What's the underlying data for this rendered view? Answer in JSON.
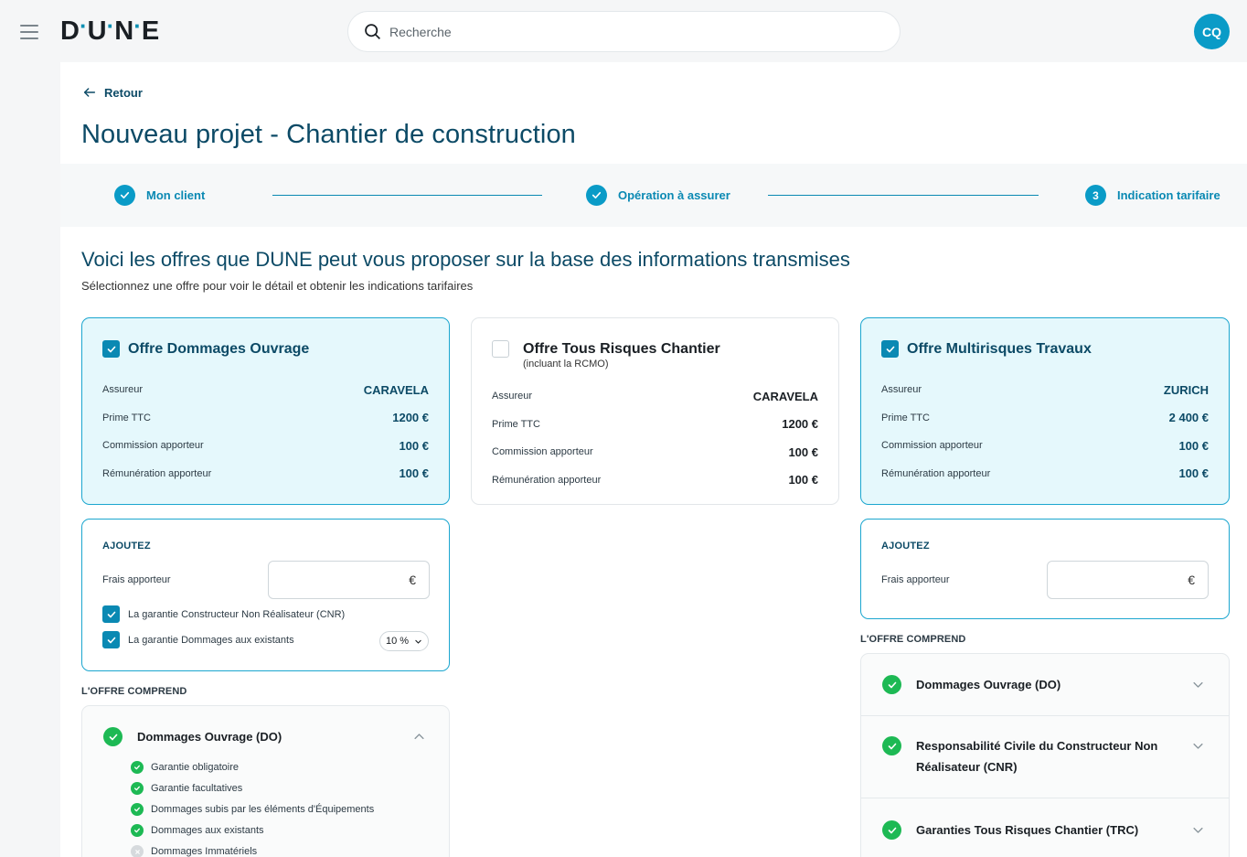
{
  "header": {
    "logo": "DUNE",
    "search_placeholder": "Recherche",
    "avatar_initials": "CQ"
  },
  "nav": {
    "back_label": "Retour",
    "page_title": "Nouveau projet - Chantier de construction"
  },
  "stepper": {
    "steps": [
      {
        "label": "Mon client",
        "state": "done"
      },
      {
        "label": "Opération à assurer",
        "state": "done"
      },
      {
        "label": "Indication tarifaire",
        "state": "current",
        "number": "3"
      }
    ]
  },
  "offers": {
    "title": "Voici les offres que DUNE peut vous proposer sur la base des informations transmises",
    "subtitle": "Sélectionnez une offre pour voir le détail et obtenir les indications tarifaires",
    "cards": [
      {
        "title": "Offre Dommages Ouvrage",
        "subtitle": "",
        "selected": true,
        "rows": [
          {
            "label": "Assureur",
            "value": "CARAVELA"
          },
          {
            "label": "Prime TTC",
            "value": "1200 €"
          },
          {
            "label": "Commission apporteur",
            "value": "100 €"
          },
          {
            "label": "Rémunération apporteur",
            "value": "100 €"
          }
        ]
      },
      {
        "title": "Offre Tous Risques Chantier",
        "subtitle": "(incluant la RCMO)",
        "selected": false,
        "rows": [
          {
            "label": "Assureur",
            "value": "CARAVELA"
          },
          {
            "label": "Prime TTC",
            "value": "1200 €"
          },
          {
            "label": "Commission apporteur",
            "value": "100 €"
          },
          {
            "label": "Rémunération apporteur",
            "value": "100 €"
          }
        ]
      },
      {
        "title": "Offre Multirisques Travaux",
        "subtitle": "",
        "selected": true,
        "rows": [
          {
            "label": "Assureur",
            "value": "ZURICH"
          },
          {
            "label": "Prime TTC",
            "value": "2 400 €"
          },
          {
            "label": "Commission apporteur",
            "value": "100 €"
          },
          {
            "label": "Rémunération apporteur",
            "value": "100 €"
          }
        ]
      }
    ]
  },
  "addons": {
    "title": "AJOUTEZ",
    "fee_label": "Frais apporteur",
    "currency": "€",
    "cnr_label": "La garantie Constructeur Non Réalisateur (CNR)",
    "cnr_checked": true,
    "existing_label": "La garantie Dommages aux existants",
    "existing_checked": true,
    "existing_rate": "10 %"
  },
  "included": {
    "section_label": "L'OFFRE COMPREND",
    "left": {
      "title": "Dommages Ouvrage (DO)",
      "expanded": true,
      "items": [
        {
          "label": "Garantie obligatoire",
          "included": true
        },
        {
          "label": "Garantie facultatives",
          "included": true
        },
        {
          "label": "Dommages subis par les éléments d'Équipements",
          "included": true
        },
        {
          "label": "Dommages aux existants",
          "included": true
        },
        {
          "label": "Dommages Immatériels",
          "included": false
        }
      ]
    },
    "right": [
      {
        "title_line1": "Dommages Ouvrage (DO)",
        "title_line2": ""
      },
      {
        "title_line1": "Responsabilité Civile du Constructeur Non",
        "title_line2": "Réalisateur (CNR)"
      },
      {
        "title_line1": "Garanties Tous Risques Chantier (TRC)",
        "title_line2": ""
      }
    ]
  },
  "colors": {
    "brand": "#0a9bc7",
    "title": "#0c4a66",
    "success": "#1db954",
    "selected_bg": "#e5f8fc"
  }
}
